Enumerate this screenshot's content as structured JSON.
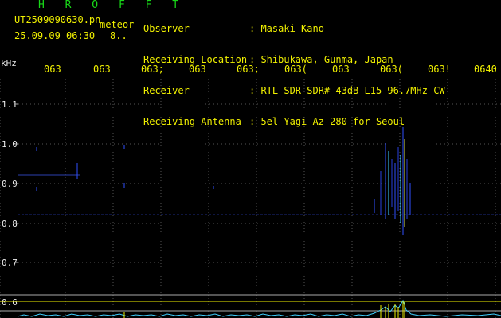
{
  "header": {
    "app_title": "H R O F F T",
    "file_name": "UT2509090630.pn",
    "mode_label": "meteor",
    "timestamp": "25.09.09 06:30",
    "timestamp_extra": "8..",
    "info_labels": [
      "Observer",
      "Receiving Location",
      "Receiver",
      "Receiving Antenna"
    ],
    "info_values": [
      ": Masaki Kano",
      ": Shibukawa, Gunma, Japan",
      ": RTL-SDR SDR# 43dB L15 96.7MHz CW",
      ": 5el Yagi Az 280 for Seoul"
    ]
  },
  "axis": {
    "y_unit": "kHz",
    "y_ticks": [
      "1.1",
      "1.0",
      "0.9",
      "0.8",
      "0.7",
      "0.6"
    ],
    "x_ticks": [
      "063",
      "063",
      "063;",
      "063",
      "063;",
      "063(",
      "063",
      "063(",
      "063!",
      "0640"
    ]
  },
  "colors": {
    "background": "#000000",
    "grid": "#444444",
    "label_yellow": "#f0f000",
    "title_green": "#18d818",
    "signal_blue": "#3050ff",
    "signal_cyan": "#40d0ff"
  }
}
